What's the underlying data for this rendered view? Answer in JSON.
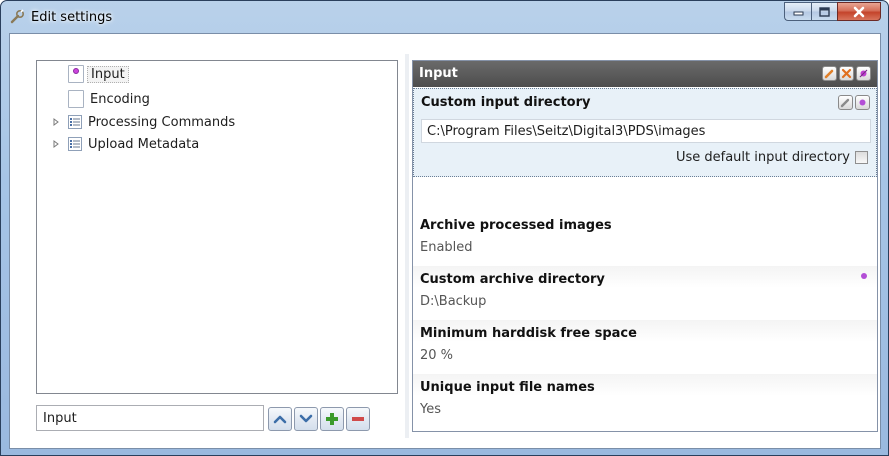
{
  "window": {
    "title": "Edit settings"
  },
  "tree": {
    "items": [
      {
        "label": "Input",
        "icon": "document-marked-icon",
        "selected": true
      },
      {
        "label": "Encoding",
        "icon": "document-icon"
      },
      {
        "label": "Processing Commands",
        "icon": "list-icon",
        "expandable": true
      },
      {
        "label": "Upload Metadata",
        "icon": "list-icon",
        "expandable": true
      }
    ]
  },
  "search": {
    "value": "Input"
  },
  "buttons": {
    "up": "chevron-up-icon",
    "down": "chevron-down-icon",
    "add": "plus-icon",
    "remove": "minus-icon"
  },
  "properties": {
    "header": "Input",
    "items": [
      {
        "name": "Custom input directory",
        "value": "C:\\Program Files\\Seitz\\Digital3\\PDS\\images",
        "checkbox_label": "Use default input directory",
        "checkbox_checked": false
      },
      {
        "name": "Archive processed images",
        "value": "Enabled"
      },
      {
        "name": "Custom archive directory",
        "value": "D:\\Backup"
      },
      {
        "name": "Minimum harddisk free space",
        "value": "20 %"
      },
      {
        "name": "Unique input file names",
        "value": "Yes"
      }
    ]
  },
  "colors": {
    "accent_purple": "#b34fd6",
    "header_dark": "#4d4d4d",
    "add_green": "#3a9a2a",
    "remove_red": "#d04a4a"
  }
}
